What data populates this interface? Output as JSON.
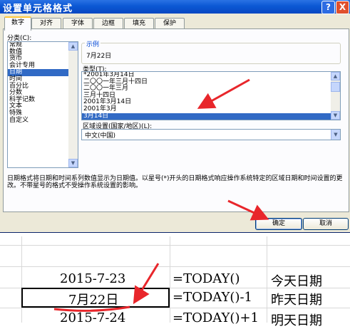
{
  "dialog": {
    "title": "设置单元格格式",
    "help_label": "?",
    "close_label": "X",
    "tabs": [
      "数字",
      "对齐",
      "字体",
      "边框",
      "填充",
      "保护"
    ],
    "category_label": "分类(C):",
    "categories": [
      "常规",
      "数值",
      "货币",
      "会计专用",
      "日期",
      "时间",
      "百分比",
      "分数",
      "科学记数",
      "文本",
      "特殊",
      "自定义"
    ],
    "selected_category": "日期",
    "sample_label": "示例",
    "sample_value": "7月22日",
    "type_label": "类型(T):",
    "types": [
      "*2001年3月14日",
      "二〇〇一年三月十四日",
      "二〇〇一年三月",
      "三月十四日",
      "2001年3月14日",
      "2001年3月",
      "3月14日"
    ],
    "selected_type": "3月14日",
    "locale_label": "区域设置(国家/地区)(L):",
    "locale_value": "中文(中国)",
    "description": "日期格式将日期和时间系列数值显示为日期值。以星号(*)开头的日期格式响应操作系统特定的区域日期和时间设置的更改。不带星号的格式不受操作系统设置的影响。",
    "ok_label": "确定",
    "cancel_label": "取消"
  },
  "sheet": {
    "rows": [
      {
        "value": "2015-7-23",
        "formula": "=TODAY()",
        "note": "今天日期"
      },
      {
        "value": "7月22日",
        "formula": "=TODAY()-1",
        "note": "昨天日期"
      },
      {
        "value": "2015-7-24",
        "formula": "=TODAY()+1",
        "note": "明天日期"
      }
    ]
  },
  "colors": {
    "title_bar": "#0b58d4",
    "selection": "#316ac5",
    "annotation": "#e8262b"
  }
}
